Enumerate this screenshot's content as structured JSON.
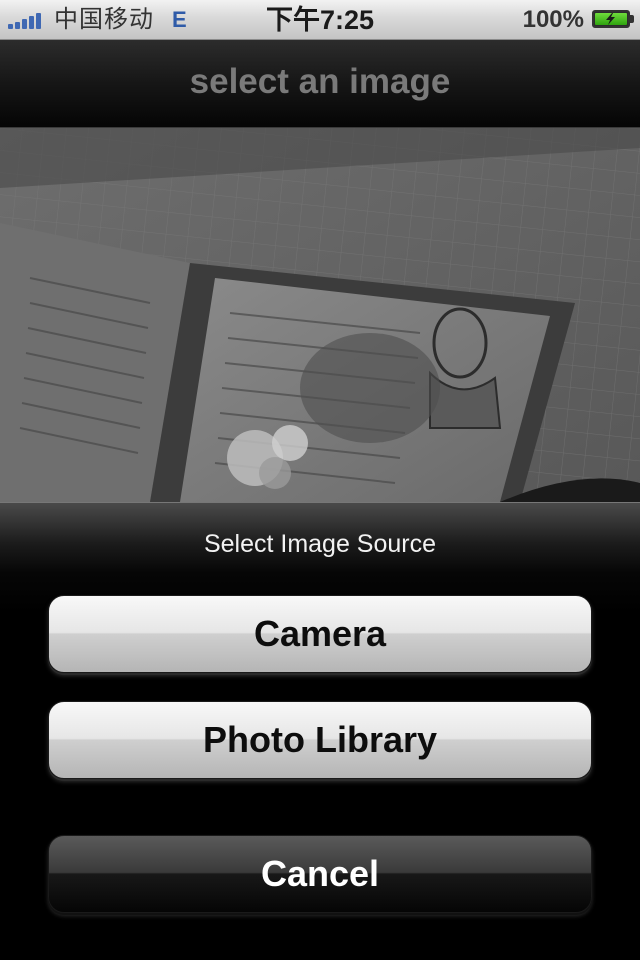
{
  "status_bar": {
    "carrier": "中国移动",
    "network": "E",
    "time": "下午7:25",
    "battery_percent": "100%",
    "signal_bars": 5,
    "battery_level": 1.0,
    "icons": [
      "signal-strength-icon",
      "battery-charging-icon"
    ]
  },
  "nav_bar": {
    "title": "select an image"
  },
  "preview": {
    "description_icon": "photo-preview"
  },
  "action_sheet": {
    "title": "Select Image Source",
    "buttons": {
      "camera": "Camera",
      "photo_library": "Photo Library",
      "cancel": "Cancel"
    }
  },
  "colors": {
    "status_bar_bg": "#d9d9d9",
    "nav_bar_bg": "#111111",
    "nav_title": "#7a7a7a",
    "signal": "#3f68b3",
    "battery": "#3bb41a",
    "sheet_bg": "#000000"
  }
}
